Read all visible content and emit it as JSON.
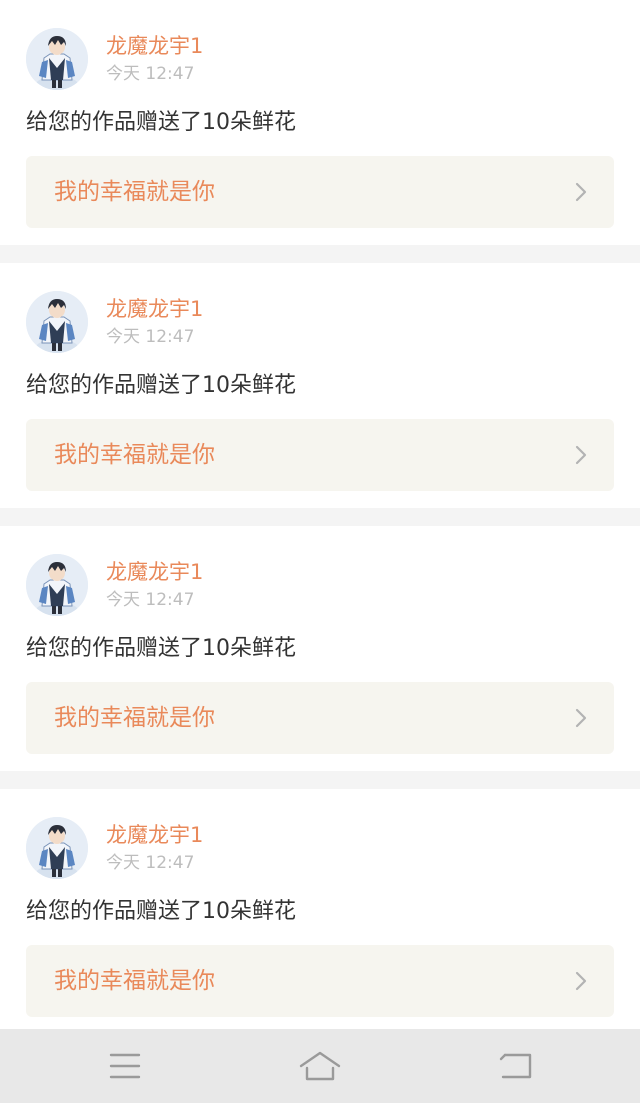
{
  "notifications": [
    {
      "username": "龙魔龙宇1",
      "time": "今天 12:47",
      "message": "给您的作品赠送了10朵鲜花",
      "work_title": "我的幸福就是你",
      "avatar_icon": "anime-character-avatar"
    },
    {
      "username": "龙魔龙宇1",
      "time": "今天 12:47",
      "message": "给您的作品赠送了10朵鲜花",
      "work_title": "我的幸福就是你",
      "avatar_icon": "anime-character-avatar"
    },
    {
      "username": "龙魔龙宇1",
      "time": "今天 12:47",
      "message": "给您的作品赠送了10朵鲜花",
      "work_title": "我的幸福就是你",
      "avatar_icon": "anime-character-avatar"
    },
    {
      "username": "龙魔龙宇1",
      "time": "今天 12:47",
      "message": "给您的作品赠送了10朵鲜花",
      "work_title": "我的幸福就是你",
      "avatar_icon": "anime-character-avatar"
    }
  ],
  "system_nav": {
    "buttons": [
      "menu-icon",
      "home-icon",
      "back-icon"
    ]
  },
  "colors": {
    "accent": "#e9895a",
    "message_text": "#333333",
    "time_text": "#bdbdbd",
    "link_background": "#f6f5ef",
    "separator": "#f4f4f4",
    "nav_background": "#e8e8e8"
  }
}
